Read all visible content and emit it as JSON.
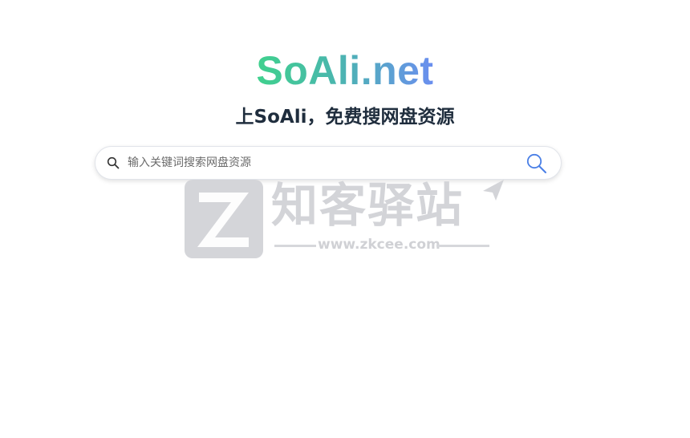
{
  "header": {
    "logo_text": "SoAli.net",
    "tagline": "上SoAli，免费搜网盘资源"
  },
  "search": {
    "placeholder": "输入关键词搜索网盘资源",
    "value": ""
  },
  "watermark": {
    "title": "知客驿站",
    "url": "www.zkcee.com"
  },
  "icons": {
    "left": "search-icon",
    "right": "search-button-icon",
    "watermark_logo": "z-logo-icon"
  },
  "colors": {
    "logo_gradient_start": "#3fd18d",
    "logo_gradient_end": "#6b8ef0",
    "tagline": "#1f2d3d",
    "search_button_icon": "#4a7fe6",
    "watermark": "#d3d4d8"
  }
}
